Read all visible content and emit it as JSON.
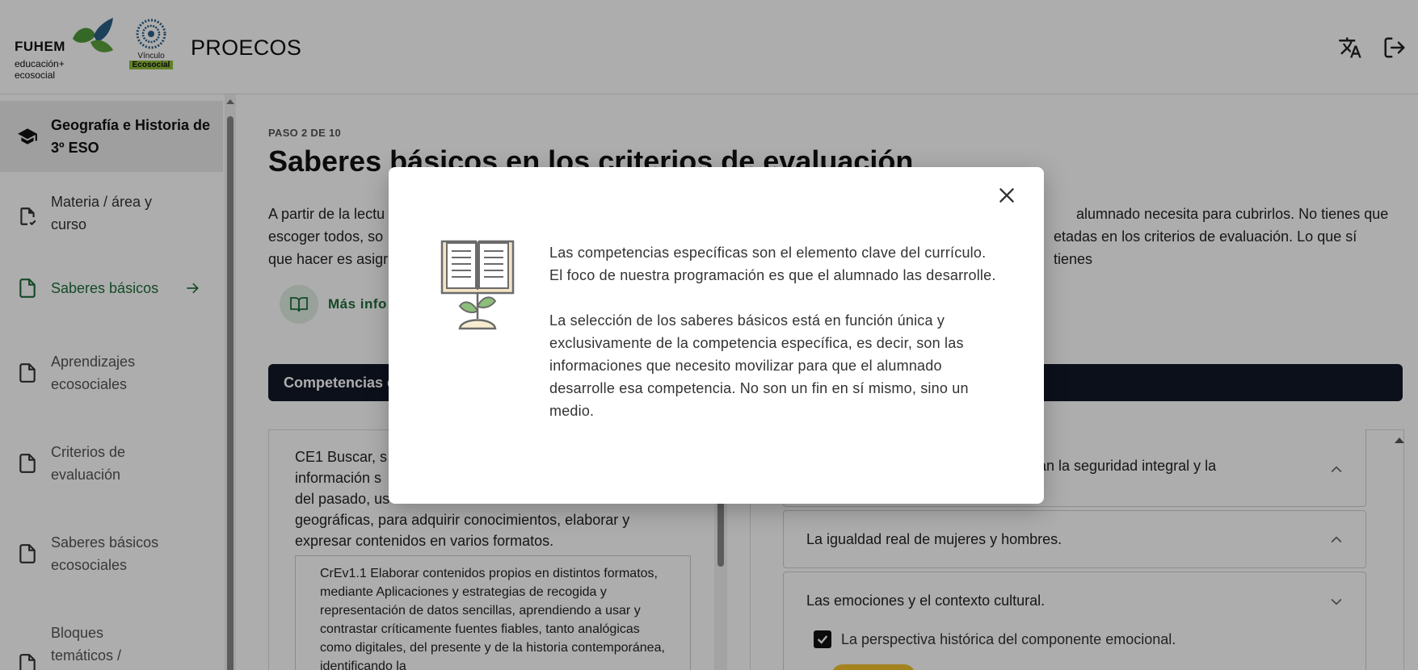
{
  "header": {
    "fuhem_word": "FUHEM",
    "fuhem_sub_line1": "educación+",
    "fuhem_sub_line2": "ecosocial",
    "vinculo_line1": "Vínculo",
    "vinculo_line2": "Ecosocial",
    "app_title": "PROECOS",
    "translate_icon": "translate-icon",
    "logout_icon": "logout-icon"
  },
  "sidebar": {
    "course": {
      "icon": "graduation-cap-icon",
      "label_line1": "Geografía e Historia de",
      "label_line2": "3º ESO"
    },
    "items": [
      {
        "icon": "document-check-icon",
        "line1": "Materia / área y",
        "line2": "curso"
      },
      {
        "icon": "document-icon",
        "line1": "Saberes básicos",
        "line2": ""
      },
      {
        "icon": "document-icon",
        "line1": "Aprendizajes",
        "line2": "ecosociales"
      },
      {
        "icon": "document-icon",
        "line1": "Criterios de",
        "line2": "evaluación"
      },
      {
        "icon": "document-icon",
        "line1": "Saberes básicos",
        "line2": "ecosociales"
      },
      {
        "icon": "document-icon",
        "line1": "Bloques",
        "line2": "temáticos /"
      }
    ]
  },
  "main": {
    "step": "PASO 2 DE 10",
    "title": "Saberes básicos en los criterios de evaluación",
    "intro_visible_left": "A partir de la lectu",
    "intro_visible_right1": "alumnado necesita para cubrirlos. No tienes que",
    "intro_visible_mid": "escoger todos, so",
    "intro_visible_right2": "etadas en los criterios de evaluación. Lo que sí tienes",
    "intro_visible_line3": "que hacer es asigr",
    "more_info": "Más info",
    "dark_bar_label": "Competencias e",
    "ce_text": "CE1 Buscar, s… información s… del pasado, us… geográficas, para adquirir conocimientos, elaborar y expresar contenidos en varios formatos.",
    "ce_line1": "CE1 Buscar, s",
    "ce_line2": "información s",
    "ce_line3": "del pasado, us",
    "ce_line4": "geográficas, para adquirir conocimientos, elaborar y",
    "ce_line5": "expresar contenidos en varios formatos.",
    "crev_text": "CrEv1.1 Elaborar contenidos propios en distintos formatos, mediante Aplicaciones y estrategias de recogida y representación de datos sencillas, aprendiendo a usar y contrastar críticamente fuentes fiables, tanto analógicas como digitales, del presente y de la historia contemporánea, identificando la",
    "accordions": [
      {
        "label": "izan la seguridad integral y la",
        "expanded": true
      },
      {
        "label": "La igualdad real de mujeres y hombres.",
        "expanded": true
      },
      {
        "label": "Las emociones y el contexto cultural.",
        "expanded": false
      }
    ],
    "checkbox_label": "La perspectiva histórica del componente emocional.",
    "checkbox_checked": true
  },
  "modal": {
    "close_icon": "close-icon",
    "illustration": "book-plant-icon",
    "paragraph1": "Las competencias específicas son el elemento clave del currículo. El foco de nuestra programación es que el alumnado las desarrolle.",
    "paragraph2": "La selección de los saberes básicos está en función única y exclusivamente de la competencia específica, es decir, son las informaciones que necesito movilizar para que el alumnado desarrolle esa competencia. No son un fin en sí mismo, sino un medio."
  },
  "colors": {
    "accent_green": "#1f6e3a",
    "dark_bar": "#111827",
    "overlay": "rgba(0,0,0,0.32)",
    "pill_yellow": "#f2c12e"
  }
}
